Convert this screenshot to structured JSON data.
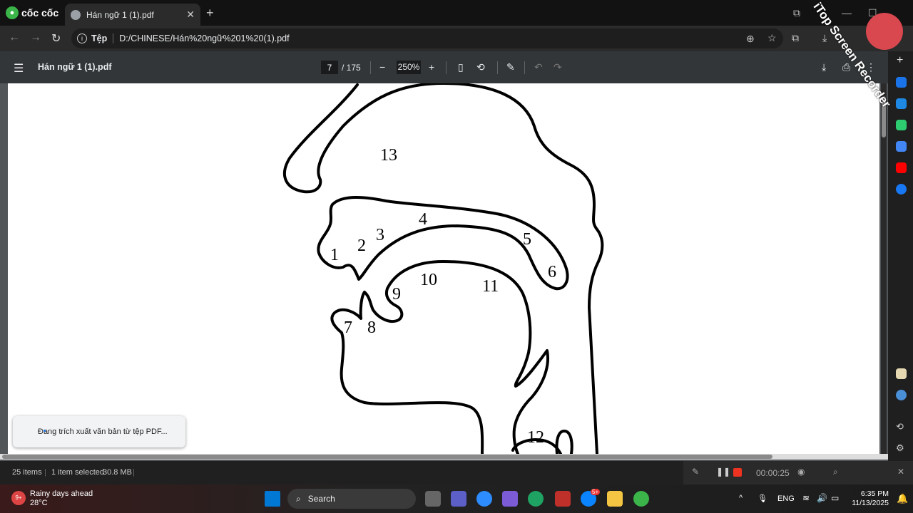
{
  "browser": {
    "brand": "cốc cốc",
    "tab_title": "Hán ngữ 1 (1).pdf",
    "address_chip": "Tệp",
    "url": "D:/CHINESE/Hán%20ngữ%201%20(1).pdf"
  },
  "pdf": {
    "filename": "Hán ngữ 1 (1).pdf",
    "current_page": "7",
    "total_pages": "/ 175",
    "zoom": "250%",
    "toast": "Đang trích xuất văn bản từ tệp PDF...",
    "diagram_labels": [
      "1",
      "2",
      "3",
      "4",
      "5",
      "6",
      "7",
      "8",
      "9",
      "10",
      "11",
      "12",
      "13"
    ]
  },
  "explorer": {
    "items": "25 items",
    "selected": "1 item selected",
    "size": "30.8 MB"
  },
  "recorder": {
    "timer": "00:00:25",
    "watermark": "iTop Screen Recorder"
  },
  "taskbar": {
    "weather_title": "Rainy days ahead",
    "weather_temp": "28°C",
    "weather_badge": "9+",
    "search_placeholder": "Search",
    "language": "ENG",
    "time": "6:35 PM",
    "date": "11/13/2025",
    "chat_badge": "5+"
  }
}
